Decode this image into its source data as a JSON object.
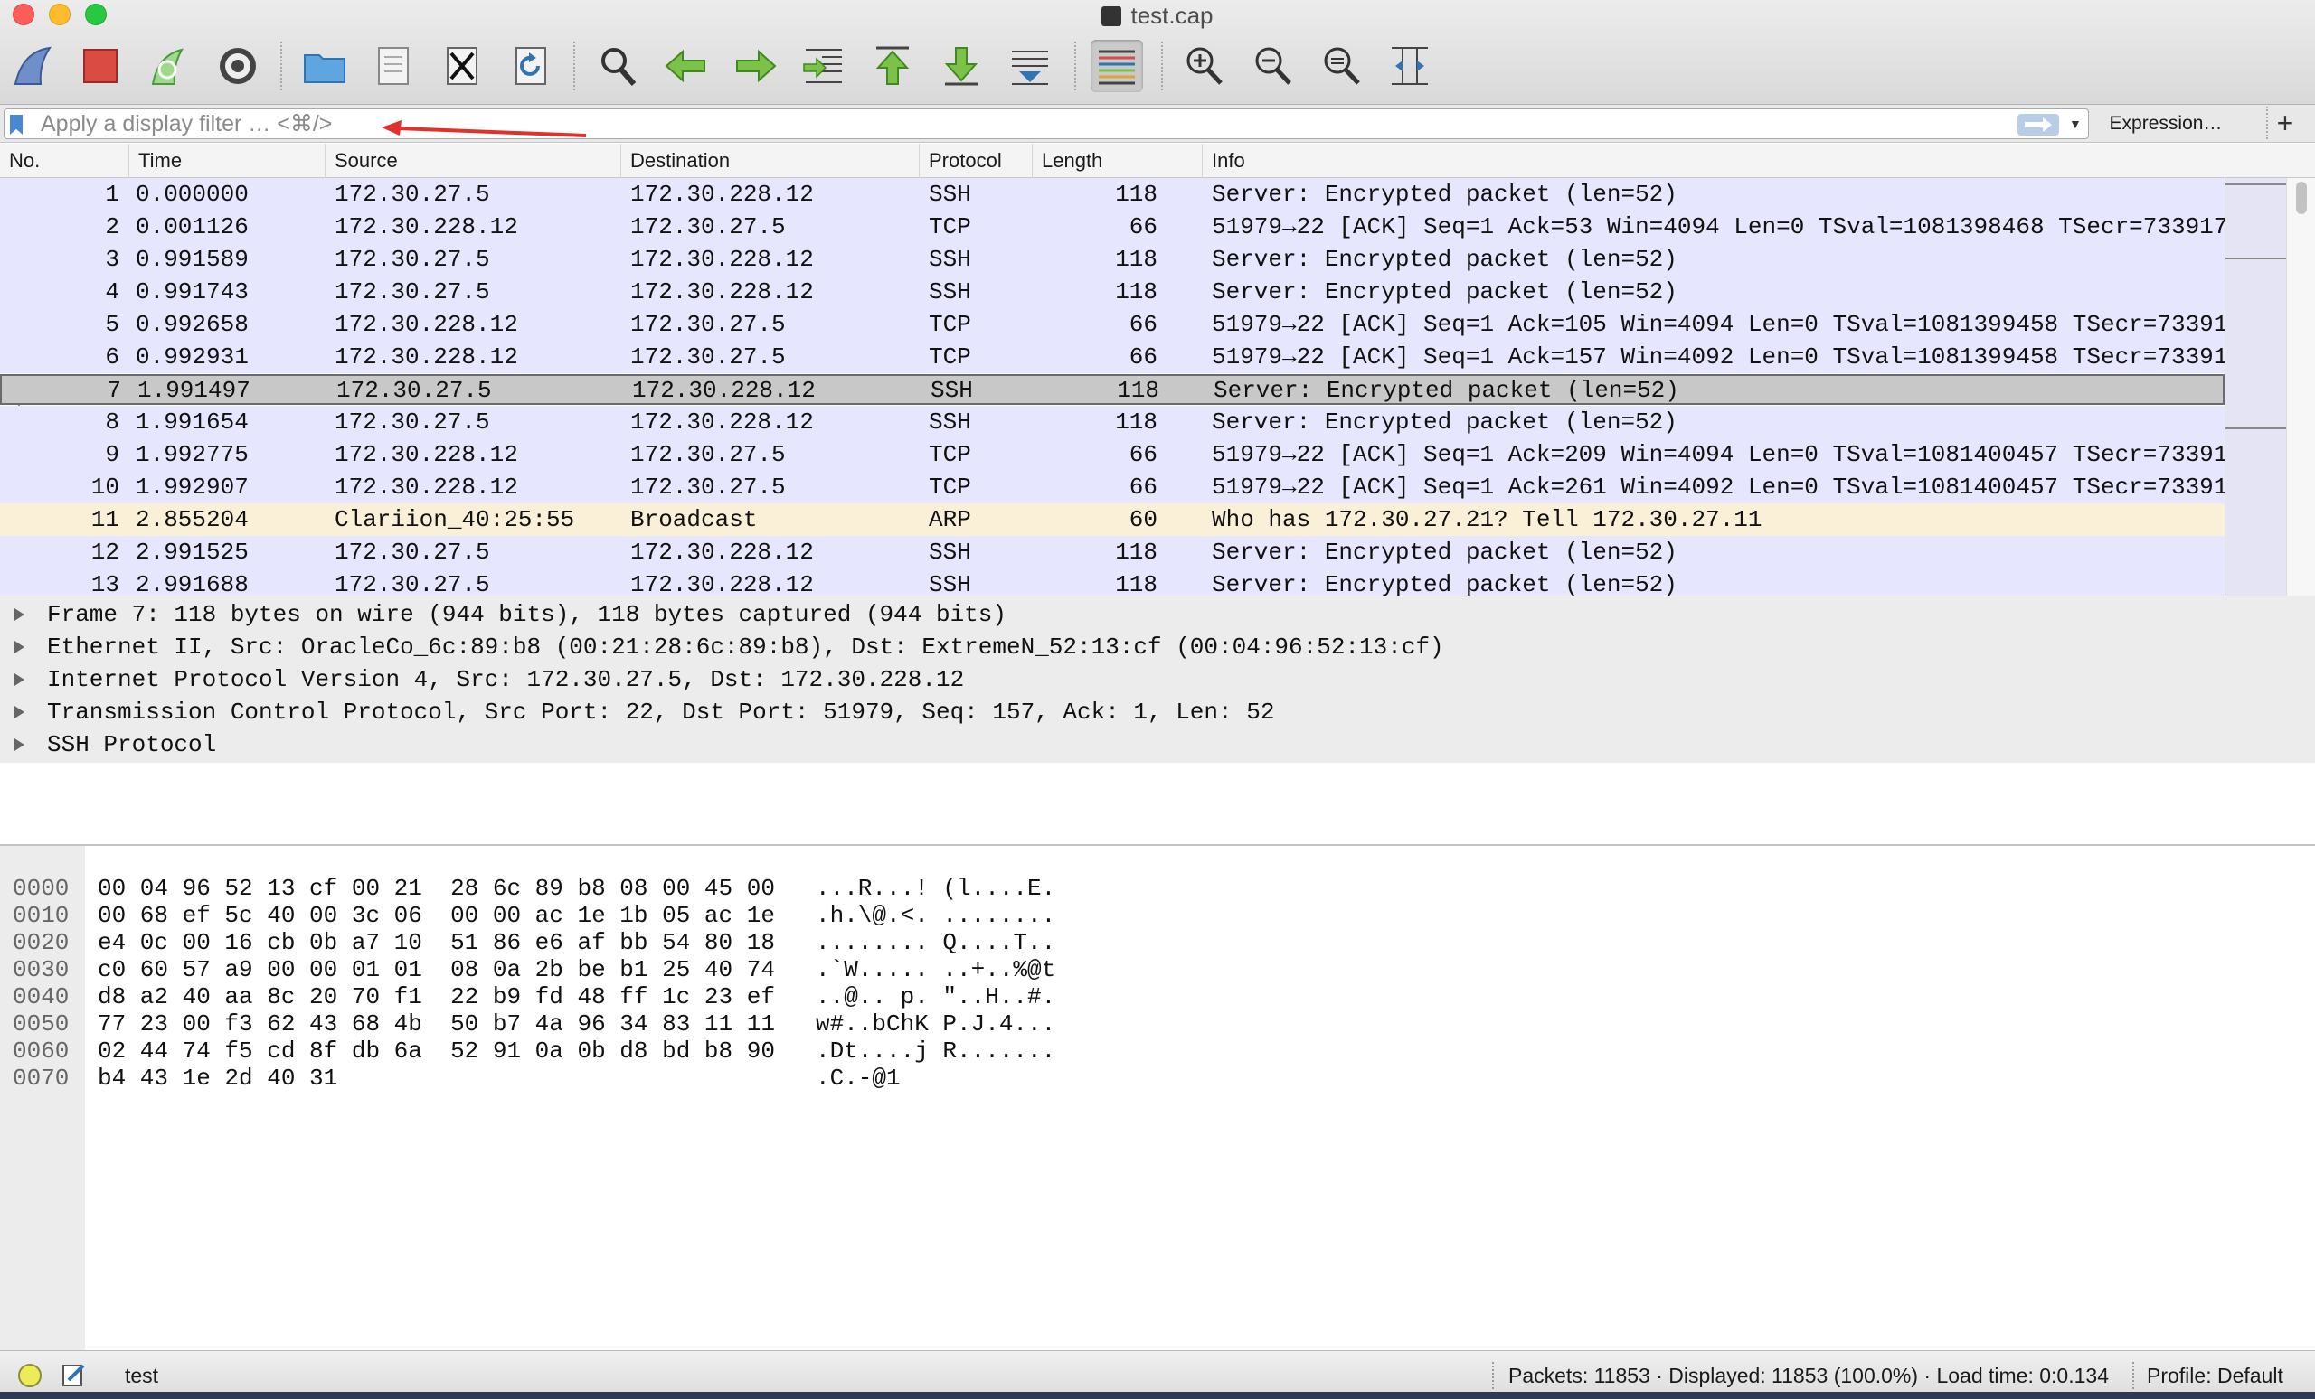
{
  "window": {
    "title": "test.cap"
  },
  "toolbar": {
    "buttons": [
      "start-capture-icon",
      "stop-capture-icon",
      "restart-capture-icon",
      "capture-options-icon",
      "open-file-icon",
      "save-file-icon",
      "close-file-icon",
      "reload-file-icon",
      "find-packet-icon",
      "go-back-icon",
      "go-forward-icon",
      "go-to-packet-icon",
      "go-first-icon",
      "go-last-icon",
      "autoscroll-icon",
      "colorize-icon",
      "zoom-in-icon",
      "zoom-out-icon",
      "zoom-normal-icon",
      "resize-columns-icon"
    ]
  },
  "filter": {
    "placeholder": "Apply a display filter … <⌘/>",
    "value": "",
    "expression_label": "Expression…",
    "add_label": "+"
  },
  "columns": {
    "no": "No.",
    "time": "Time",
    "source": "Source",
    "destination": "Destination",
    "protocol": "Protocol",
    "length": "Length",
    "info": "Info"
  },
  "packets": [
    {
      "no": "1",
      "time": "0.000000",
      "src": "172.30.27.5",
      "dst": "172.30.228.12",
      "proto": "SSH",
      "len": "118",
      "info": "Server: Encrypted packet (len=52)"
    },
    {
      "no": "2",
      "time": "0.001126",
      "src": "172.30.228.12",
      "dst": "172.30.27.5",
      "proto": "TCP",
      "len": "66",
      "info": "51979→22 [ACK] Seq=1 Ack=53 Win=4094 Len=0 TSval=1081398468 TSecr=733917"
    },
    {
      "no": "3",
      "time": "0.991589",
      "src": "172.30.27.5",
      "dst": "172.30.228.12",
      "proto": "SSH",
      "len": "118",
      "info": "Server: Encrypted packet (len=52)"
    },
    {
      "no": "4",
      "time": "0.991743",
      "src": "172.30.27.5",
      "dst": "172.30.228.12",
      "proto": "SSH",
      "len": "118",
      "info": "Server: Encrypted packet (len=52)"
    },
    {
      "no": "5",
      "time": "0.992658",
      "src": "172.30.228.12",
      "dst": "172.30.27.5",
      "proto": "TCP",
      "len": "66",
      "info": "51979→22 [ACK] Seq=1 Ack=105 Win=4094 Len=0 TSval=1081399458 TSecr=73391"
    },
    {
      "no": "6",
      "time": "0.992931",
      "src": "172.30.228.12",
      "dst": "172.30.27.5",
      "proto": "TCP",
      "len": "66",
      "info": "51979→22 [ACK] Seq=1 Ack=157 Win=4092 Len=0 TSval=1081399458 TSecr=73391"
    },
    {
      "no": "7",
      "time": "1.991497",
      "src": "172.30.27.5",
      "dst": "172.30.228.12",
      "proto": "SSH",
      "len": "118",
      "info": "Server: Encrypted packet (len=52)"
    },
    {
      "no": "8",
      "time": "1.991654",
      "src": "172.30.27.5",
      "dst": "172.30.228.12",
      "proto": "SSH",
      "len": "118",
      "info": "Server: Encrypted packet (len=52)"
    },
    {
      "no": "9",
      "time": "1.992775",
      "src": "172.30.228.12",
      "dst": "172.30.27.5",
      "proto": "TCP",
      "len": "66",
      "info": "51979→22 [ACK] Seq=1 Ack=209 Win=4094 Len=0 TSval=1081400457 TSecr=73391"
    },
    {
      "no": "10",
      "time": "1.992907",
      "src": "172.30.228.12",
      "dst": "172.30.27.5",
      "proto": "TCP",
      "len": "66",
      "info": "51979→22 [ACK] Seq=1 Ack=261 Win=4092 Len=0 TSval=1081400457 TSecr=73391"
    },
    {
      "no": "11",
      "time": "2.855204",
      "src": "Clariion_40:25:55",
      "dst": "Broadcast",
      "proto": "ARP",
      "len": "60",
      "info": "Who has 172.30.27.21? Tell 172.30.27.11"
    },
    {
      "no": "12",
      "time": "2.991525",
      "src": "172.30.27.5",
      "dst": "172.30.228.12",
      "proto": "SSH",
      "len": "118",
      "info": "Server: Encrypted packet (len=52)"
    },
    {
      "no": "13",
      "time": "2.991688",
      "src": "172.30.27.5",
      "dst": "172.30.228.12",
      "proto": "SSH",
      "len": "118",
      "info": "Server: Encrypted packet (len=52)"
    }
  ],
  "selected_packet": "7",
  "details": [
    "Frame 7: 118 bytes on wire (944 bits), 118 bytes captured (944 bits)",
    "Ethernet II, Src: OracleCo_6c:89:b8 (00:21:28:6c:89:b8), Dst: ExtremeN_52:13:cf (00:04:96:52:13:cf)",
    "Internet Protocol Version 4, Src: 172.30.27.5, Dst: 172.30.228.12",
    "Transmission Control Protocol, Src Port: 22, Dst Port: 51979, Seq: 157, Ack: 1, Len: 52",
    "SSH Protocol"
  ],
  "bytes": [
    {
      "offset": "0000",
      "hex": "00 04 96 52 13 cf 00 21  28 6c 89 b8 08 00 45 00",
      "ascii": "...R...! (l....E."
    },
    {
      "offset": "0010",
      "hex": "00 68 ef 5c 40 00 3c 06  00 00 ac 1e 1b 05 ac 1e",
      "ascii": ".h.\\@.<. ........"
    },
    {
      "offset": "0020",
      "hex": "e4 0c 00 16 cb 0b a7 10  51 86 e6 af bb 54 80 18",
      "ascii": "........ Q....T.."
    },
    {
      "offset": "0030",
      "hex": "c0 60 57 a9 00 00 01 01  08 0a 2b be b1 25 40 74",
      "ascii": ".`W..... ..+..%@t"
    },
    {
      "offset": "0040",
      "hex": "d8 a2 40 aa 8c 20 70 f1  22 b9 fd 48 ff 1c 23 ef",
      "ascii": "..@.. p. \"..H..#."
    },
    {
      "offset": "0050",
      "hex": "77 23 00 f3 62 43 68 4b  50 b7 4a 96 34 83 11 11",
      "ascii": "w#..bChK P.J.4..."
    },
    {
      "offset": "0060",
      "hex": "02 44 74 f5 cd 8f db 6a  52 91 0a 0b d8 bd b8 90",
      "ascii": ".Dt....j R......."
    },
    {
      "offset": "0070",
      "hex": "b4 43 1e 2d 40 31",
      "ascii": ".C.-@1"
    }
  ],
  "status": {
    "profile_name": "test",
    "packets_text": "Packets: 11853 · Displayed: 11853 (100.0%) · Load time: 0:0.134",
    "profile_text": "Profile: Default"
  },
  "colors": {
    "tcp_row": "#e7e6ff",
    "arp_row": "#faf0d7",
    "selected_row": "#c8c8c8",
    "annotation_arrow": "#e0322a"
  }
}
